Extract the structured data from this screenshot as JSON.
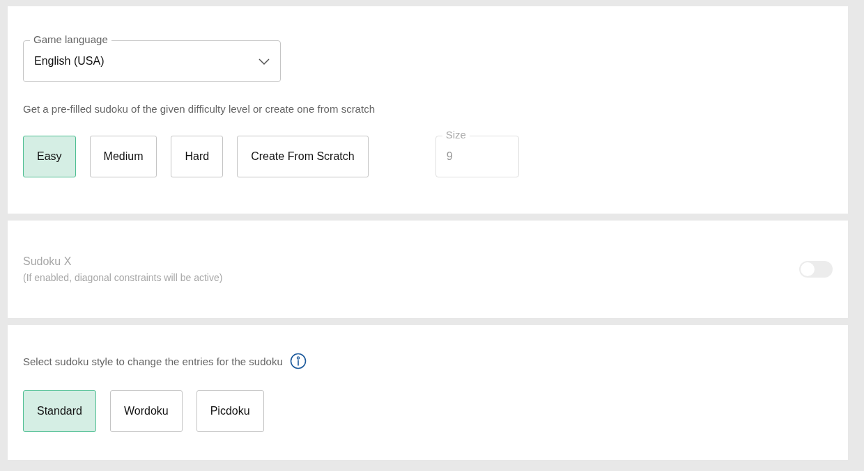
{
  "language_select": {
    "label": "Game language",
    "value": "English (USA)"
  },
  "difficulty": {
    "description": "Get a pre-filled sudoku of the given difficulty level or create one from scratch",
    "options": [
      {
        "label": "Easy",
        "selected": true
      },
      {
        "label": "Medium",
        "selected": false
      },
      {
        "label": "Hard",
        "selected": false
      },
      {
        "label": "Create From Scratch",
        "selected": false
      }
    ],
    "size_field": {
      "label": "Size",
      "value": "9",
      "disabled": true
    }
  },
  "sudoku_x": {
    "title": "Sudoku X",
    "hint": "(If enabled, diagonal constraints will be active)",
    "disabled": true,
    "on": false
  },
  "style": {
    "description": "Select sudoku style to change the entries for the sudoku",
    "options": [
      {
        "label": "Standard",
        "selected": true
      },
      {
        "label": "Wordoku",
        "selected": false
      },
      {
        "label": "Picdoku",
        "selected": false
      }
    ]
  }
}
